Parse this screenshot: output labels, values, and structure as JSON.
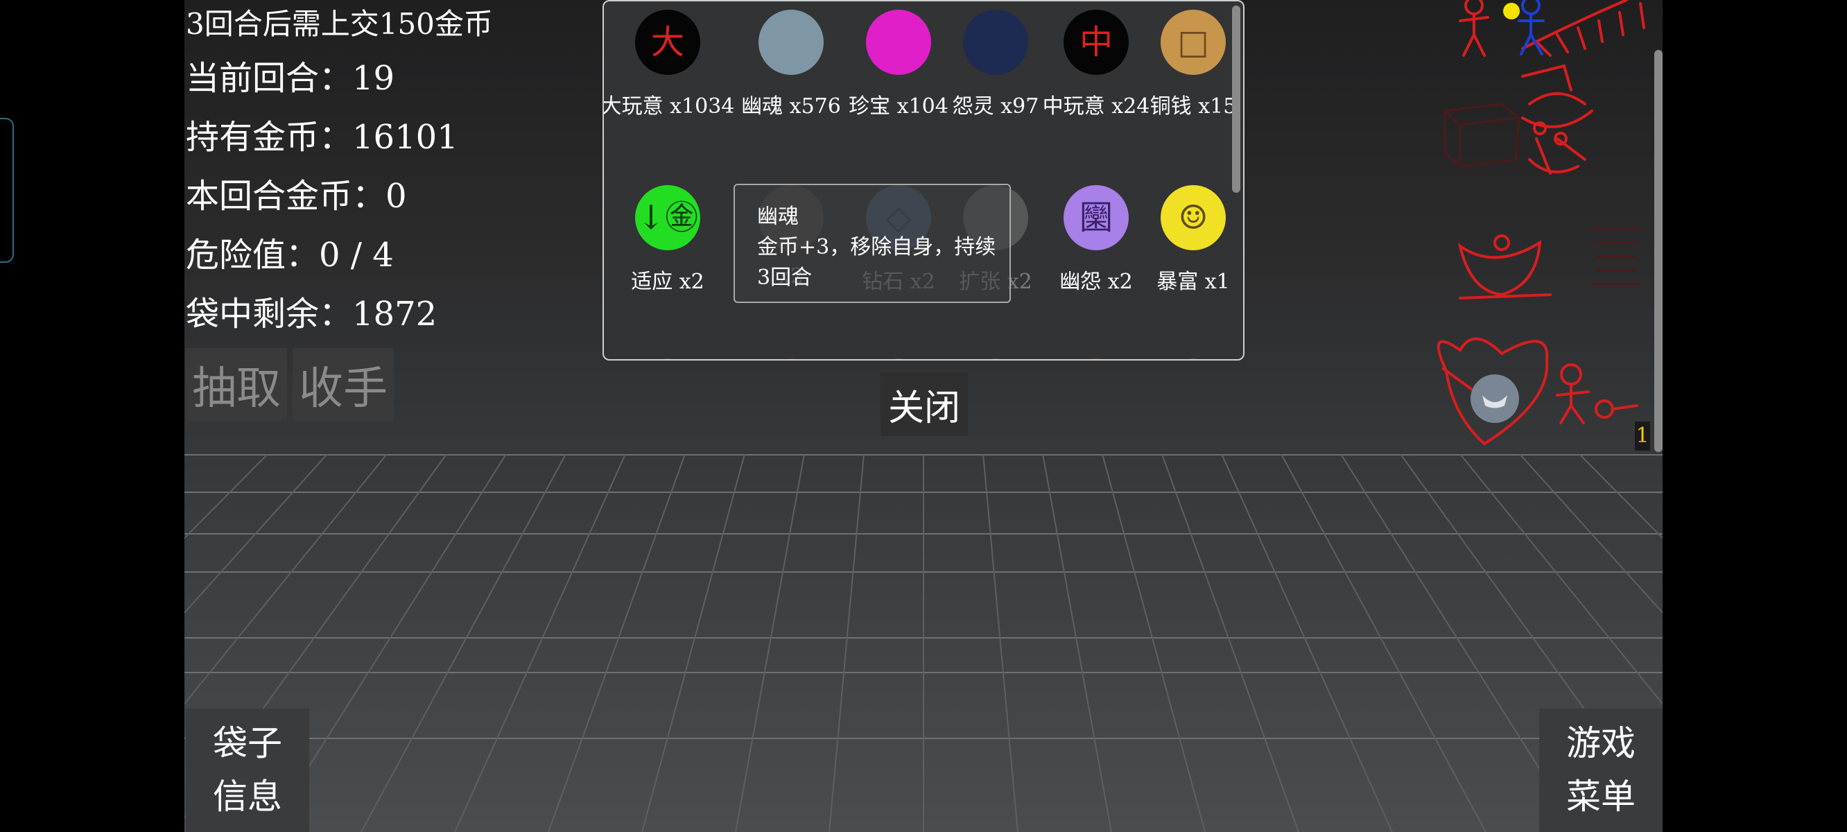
{
  "stats": {
    "tax_notice": "3回合后需上交150金币",
    "current_round": "当前回合：19",
    "gold_held": "持有金币：16101",
    "round_gold": "本回合金币：0",
    "danger": "危险值：0 / 4",
    "bag_remaining": "袋中剩余：1872"
  },
  "actions": {
    "draw_label": "抽取",
    "stop_label": "收手"
  },
  "bag_items": [
    {
      "label": "大玩意 x1034",
      "icon": "big-toy-icon",
      "bg": "#050505",
      "glyph": "大",
      "glyph_color": "#e02020"
    },
    {
      "label": "幽魂 x576",
      "icon": "ghost-icon",
      "bg": "#7f96a4",
      "glyph": "",
      "glyph_color": "#ffffff"
    },
    {
      "label": "珍宝 x104",
      "icon": "treasure-icon",
      "bg": "#e11fc8",
      "glyph": "",
      "glyph_color": "#f3d23b"
    },
    {
      "label": "怨灵 x97",
      "icon": "wraith-icon",
      "bg": "#1d2a52",
      "glyph": "",
      "glyph_color": "#ffffff"
    },
    {
      "label": "中玩意 x24",
      "icon": "mid-toy-icon",
      "bg": "#050505",
      "glyph": "中",
      "glyph_color": "#e02020"
    },
    {
      "label": "铜钱 x15",
      "icon": "copper-coin-icon",
      "bg": "#c8954d",
      "glyph": "□",
      "glyph_color": "#6b4a1c"
    },
    {
      "label": "适应 x2",
      "icon": "adapt-icon",
      "bg": "#22dd22",
      "glyph": "↓㊎",
      "glyph_color": "#0a3a0a"
    },
    {
      "label": "x2",
      "icon": "hidden-item-icon",
      "bg": "#6a6a6a",
      "glyph": "",
      "glyph_color": "#222"
    },
    {
      "label": "钻石 x2",
      "icon": "diamond-icon",
      "bg": "#6a8fbf",
      "glyph": "◇",
      "glyph_color": "#2b4a7a"
    },
    {
      "label": "扩张 x2",
      "icon": "expand-icon",
      "bg": "#9a9a9a",
      "glyph": "",
      "glyph_color": "#555"
    },
    {
      "label": "幽怨 x2",
      "icon": "resentful-ghost-icon",
      "bg": "#a780e8",
      "glyph": "圞",
      "glyph_color": "#3a1f6a"
    },
    {
      "label": "暴富 x1",
      "icon": "sudden-wealth-icon",
      "bg": "#f1e024",
      "glyph": "☺",
      "glyph_color": "#5a4d00"
    }
  ],
  "tooltip": {
    "title": "幽魂",
    "desc_line1": "金币+3，移除自身，持续",
    "desc_line2": "3回合"
  },
  "close_label": "关闭",
  "bottom_left": {
    "line1": "袋子",
    "line2": "信息"
  },
  "bottom_right": {
    "line1": "游戏",
    "line2": "菜单"
  },
  "right_panel_count": "1",
  "colors": {
    "scribble_red": "#d81e1e",
    "stickman_blue": "#1a3fd8",
    "coin_yellow": "#f4e200"
  }
}
